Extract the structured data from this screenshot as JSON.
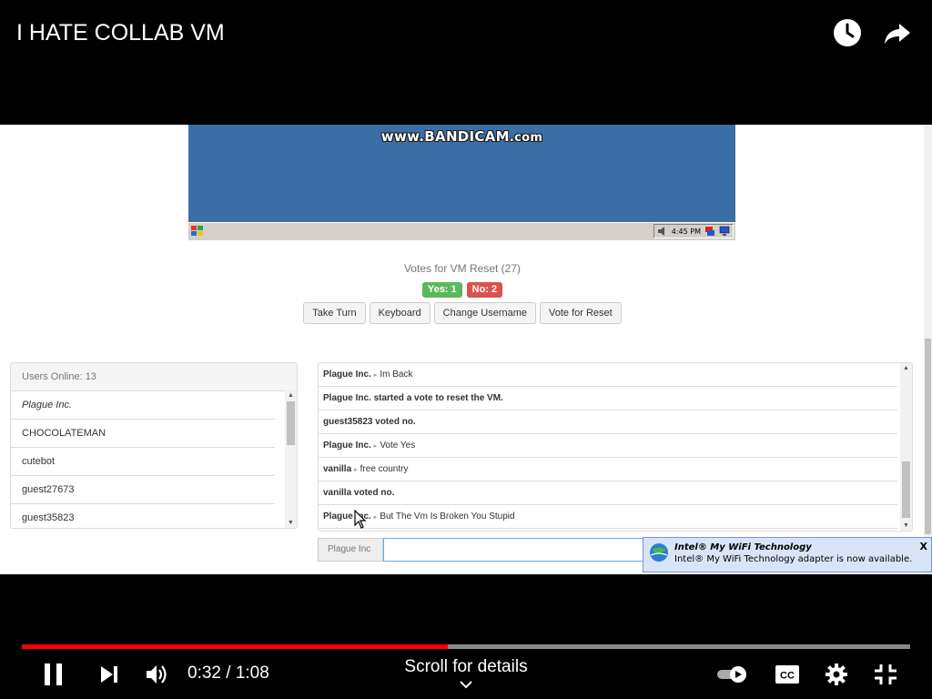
{
  "video": {
    "title": "I HATE COLLAB VM",
    "current_time": "0:32",
    "separator": " / ",
    "duration": "1:08",
    "progress_fraction": 0.48,
    "scroll_hint": "Scroll for details"
  },
  "vm": {
    "watermark_www": "www.",
    "watermark_brand": "BANDICAM",
    "watermark_domain": ".com",
    "tray_clock": "4:45 PM"
  },
  "votes": {
    "title": "Votes for VM Reset (27)",
    "yes_label": "Yes: 1",
    "no_label": "No: 2"
  },
  "buttons": {
    "take_turn": "Take Turn",
    "keyboard": "Keyboard",
    "change_username": "Change Username",
    "vote_reset": "Vote for Reset"
  },
  "users": {
    "header": "Users Online: 13",
    "list": [
      "Plague Inc.",
      "CHOCOLATEMAN",
      "cutebot",
      "guest27673",
      "guest35823"
    ]
  },
  "chat": {
    "messages": [
      {
        "user": "Plague Inc.",
        "text": "Im Back"
      },
      {
        "system": "Plague Inc. started a vote to reset the VM."
      },
      {
        "system": "guest35823 voted no."
      },
      {
        "user": "Plague Inc.",
        "text": "Vote Yes"
      },
      {
        "user": "vanilla",
        "text": "free country"
      },
      {
        "system": "vanilla voted no."
      },
      {
        "user": "Plague Inc.",
        "text": "But The Vm Is Broken You Stupid"
      }
    ],
    "input_label": "Plague Inc",
    "input_value": ""
  },
  "notification": {
    "title": "Intel® My WiFi Technology",
    "body": "Intel® My WiFi Technology adapter is now available.",
    "close": "X"
  },
  "colors": {
    "progress_played": "#ff0000",
    "vote_yes": "#5cb85c",
    "vote_no": "#d9534f",
    "vm_desktop": "#3a6ea5"
  }
}
